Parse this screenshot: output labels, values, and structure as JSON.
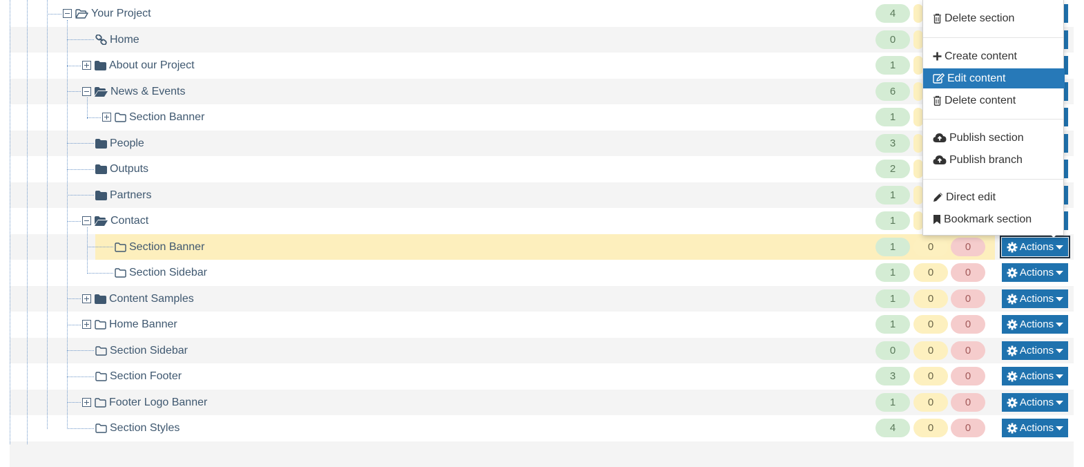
{
  "tree": {
    "rows": [
      {
        "label": "Your Project",
        "toggle": "minus",
        "icon": "folder-open-outline-icon",
        "counts": [
          "4"
        ]
      },
      {
        "label": "Home",
        "toggle": "",
        "icon": "link-icon",
        "counts": [
          "0"
        ]
      },
      {
        "label": "About our Project",
        "toggle": "plus",
        "icon": "folder-solid-icon",
        "counts": [
          "1"
        ]
      },
      {
        "label": "News & Events",
        "toggle": "minus",
        "icon": "folder-open-solid-icon",
        "counts": [
          "6"
        ]
      },
      {
        "label": "Section Banner",
        "toggle": "plus",
        "icon": "folder-outline-icon",
        "counts": [
          "1"
        ]
      },
      {
        "label": "People",
        "toggle": "",
        "icon": "folder-solid-icon",
        "counts": [
          "3"
        ]
      },
      {
        "label": "Outputs",
        "toggle": "",
        "icon": "folder-solid-icon",
        "counts": [
          "2"
        ]
      },
      {
        "label": "Partners",
        "toggle": "",
        "icon": "folder-solid-icon",
        "counts": [
          "1"
        ]
      },
      {
        "label": "Contact",
        "toggle": "minus",
        "icon": "folder-open-solid-icon",
        "counts": [
          "1"
        ]
      },
      {
        "label": "Section Banner",
        "toggle": "",
        "icon": "folder-outline-icon",
        "counts": [
          "1",
          "0",
          "0"
        ],
        "highlighted": true
      },
      {
        "label": "Section Sidebar",
        "toggle": "",
        "icon": "folder-outline-icon",
        "counts": [
          "1",
          "0",
          "0"
        ]
      },
      {
        "label": "Content Samples",
        "toggle": "plus",
        "icon": "folder-solid-icon",
        "counts": [
          "1",
          "0",
          "0"
        ]
      },
      {
        "label": "Home Banner",
        "toggle": "plus",
        "icon": "folder-outline-icon",
        "counts": [
          "1",
          "0",
          "0"
        ]
      },
      {
        "label": "Section Sidebar",
        "toggle": "",
        "icon": "folder-outline-icon",
        "counts": [
          "0",
          "0",
          "0"
        ]
      },
      {
        "label": "Section Footer",
        "toggle": "",
        "icon": "folder-outline-icon",
        "counts": [
          "3",
          "0",
          "0"
        ]
      },
      {
        "label": "Footer Logo Banner",
        "toggle": "plus",
        "icon": "folder-outline-icon",
        "counts": [
          "1",
          "0",
          "0"
        ]
      },
      {
        "label": "Section Styles",
        "toggle": "",
        "icon": "folder-outline-icon",
        "counts": [
          "4",
          "0",
          "0"
        ]
      }
    ],
    "actions_label": "Actions"
  },
  "menu": {
    "items": [
      {
        "label": "Delete section",
        "icon": "trash-icon"
      },
      {
        "label": "Create content",
        "icon": "plus-icon"
      },
      {
        "label": "Edit content",
        "icon": "edit-icon",
        "active": true
      },
      {
        "label": "Delete content",
        "icon": "trash-icon"
      },
      {
        "label": "Publish section",
        "icon": "cloud-upload-icon"
      },
      {
        "label": "Publish branch",
        "icon": "cloud-upload-icon"
      },
      {
        "label": "Direct edit",
        "icon": "pencil-icon"
      },
      {
        "label": "Bookmark section",
        "icon": "bookmark-icon"
      }
    ]
  },
  "colors": {
    "accent": "#1f72ae",
    "menu_active": "#2779b8",
    "badge_green": "#d4ecd4",
    "badge_yellow": "#fdf0bf",
    "badge_red": "#f5cccc",
    "highlight": "#fdefbd"
  }
}
